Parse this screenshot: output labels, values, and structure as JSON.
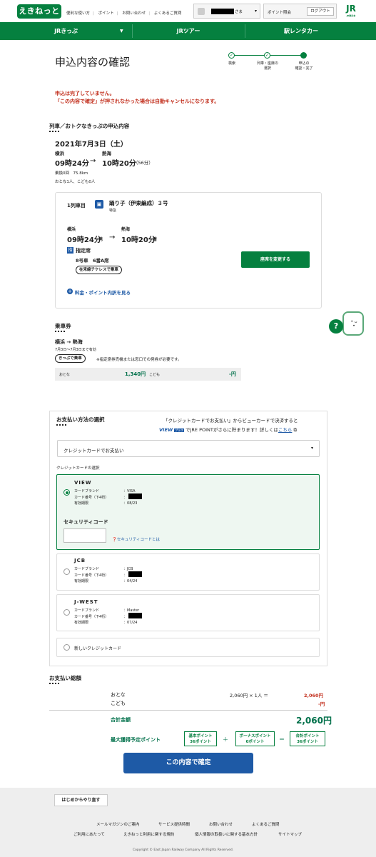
{
  "header": {
    "logo": "えきねっと",
    "links": [
      "便利な使い方",
      "ポイント",
      "お問い合わせ",
      "よくあるご質問"
    ],
    "user_suffix": "さま",
    "point_link": "ポイント照会",
    "logout": "ログアウト",
    "jr_logo": "JR",
    "jr_logo_sub": "JR東日本"
  },
  "nav": [
    "JRきっぷ",
    "JRツアー",
    "駅レンタカー"
  ],
  "page_title": "申込内容の確認",
  "steps": [
    "検索",
    "列車・座席の\n選択",
    "申込の\n確認・完了"
  ],
  "warning": [
    "申込は完了していません。",
    "「この内容で確定」が押されなかった場合は自動キャンセルになります。"
  ],
  "trip": {
    "section_title": "列車／おトクなきっぷの申込内容",
    "date": "2021年7月3日（土）",
    "from": "横浜",
    "to": "熱海",
    "dep_time": "09時24分",
    "arrow": "→",
    "arr_time": "10時20分",
    "duration": "（56分）",
    "transfers": "乗換0回　75.8km",
    "passengers": "おとな1人、こども0人"
  },
  "train": {
    "index": "1列車目",
    "name": "踊り子（伊東編成）３号",
    "type": "特急",
    "dep_station": "横浜",
    "arr_station": "熱海",
    "dep_time": "09時24分",
    "dep_suffix": "発",
    "arr_time": "10時20分",
    "arr_suffix": "着",
    "seat_badge": "指",
    "seat_class": "指定席",
    "car": "8号車　6番A席",
    "ticketless": "在来線チケレスで乗車",
    "change_seat": "座席を変更する",
    "fare_link": "料金・ポイント内訳を見る"
  },
  "ticket": {
    "section_title": "乗車券",
    "route": "横浜 → 熱海",
    "validity": "7月3日〜7月3日まで有効",
    "method": "きっぷで乗車",
    "note": "※指定席券売機または窓口での発券が必要です。",
    "adult_label": "おとな",
    "adult_price": "1,340円",
    "child_label": "こども",
    "child_price": "-円"
  },
  "payment": {
    "section_title": "お支払い方法の選択",
    "promo_line1": "「クレジットカードでお支払い」からビューカードで決済すると",
    "promo_view": "VIEW",
    "promo_plus": "プラス",
    "promo_line2": "でJRE POINTがさらに貯まります！詳しくは",
    "promo_link": "こちら",
    "method_selected": "クレジットカードでお支払い",
    "card_select_label": "クレジットカードの選択",
    "brand_label": "カードブランド",
    "number_label": "カード番号（下4桁）",
    "expiry_label": "有効期限",
    "colon": "：",
    "cards": [
      {
        "name": "VIEW",
        "brand": "VISA",
        "expiry": "08/23"
      },
      {
        "name": "JCB",
        "brand": "JCB",
        "expiry": "04/24"
      },
      {
        "name": "J-WEST",
        "brand": "Master",
        "expiry": "07/24"
      }
    ],
    "security_label": "セキュリティコード",
    "security_help": "セキュリティコードとは",
    "new_card": "新しいクレジットカード"
  },
  "total": {
    "section_title": "お支払い総額",
    "adult_label": "おとな",
    "adult_calc": "2,060円 × 1人 ＝",
    "adult_amount": "2,060円",
    "child_label": "こども",
    "child_amount": "-円",
    "total_label": "合計金額",
    "total_amount": "2,060円",
    "points_label": "最大獲得予定ポイント",
    "base_points": [
      "基本ポイント",
      "36ポイント"
    ],
    "bonus_points": [
      "ボーナスポイント",
      "0ポイント"
    ],
    "sum_points": [
      "合計ポイント",
      "36ポイント"
    ],
    "plus": "＋",
    "equals": "＝"
  },
  "confirm_button": "この内容で確定",
  "footer": {
    "restart": "はじめからやり直す",
    "row1": [
      "メールマガジンのご案内",
      "サービス提供時間",
      "お問い合わせ",
      "よくあるご質問"
    ],
    "row2": [
      "ご利用にあたって",
      "えきねっと利用に関する規約",
      "個人情報の取扱いに関する基本方針",
      "サイトマップ"
    ],
    "copyright": "Copyright © East Japan Railway Company All Rights Reserved."
  },
  "help_button": "?",
  "colors": {
    "brand_green": "#05803f",
    "warning_red": "#c3311f",
    "confirm_blue": "#1e5aa6"
  }
}
